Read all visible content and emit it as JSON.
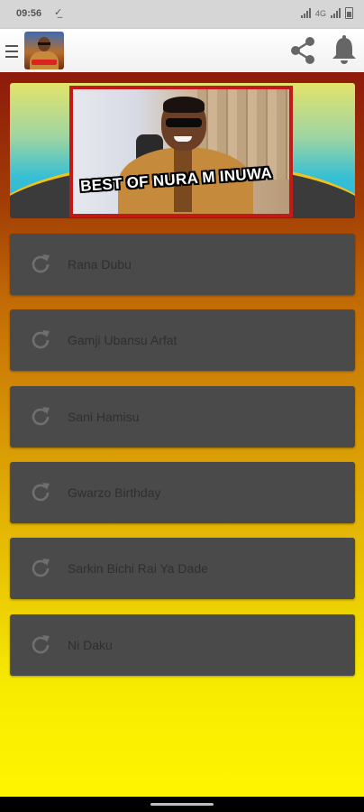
{
  "status_bar": {
    "time": "09:56",
    "network_label": "4G"
  },
  "app_bar": {
    "menu_icon": "hamburger-menu-icon",
    "share_icon": "share-icon",
    "notification_icon": "bell-icon"
  },
  "banner": {
    "title": "BEST OF NURA M INUWA"
  },
  "tracks": [
    {
      "label": "Rana Dubu"
    },
    {
      "label": "Gamji Ubansu Arfat"
    },
    {
      "label": "Sani Hamisu"
    },
    {
      "label": "Gwarzo Birthday"
    },
    {
      "label": "Sarkin Bichi Rai Ya Dade"
    },
    {
      "label": "Ni Daku"
    }
  ],
  "colors": {
    "track_background": "#4a4a4a",
    "banner_border": "#c21a1a",
    "gradient_top": "#8e1a0b",
    "gradient_bottom": "#fff500"
  }
}
